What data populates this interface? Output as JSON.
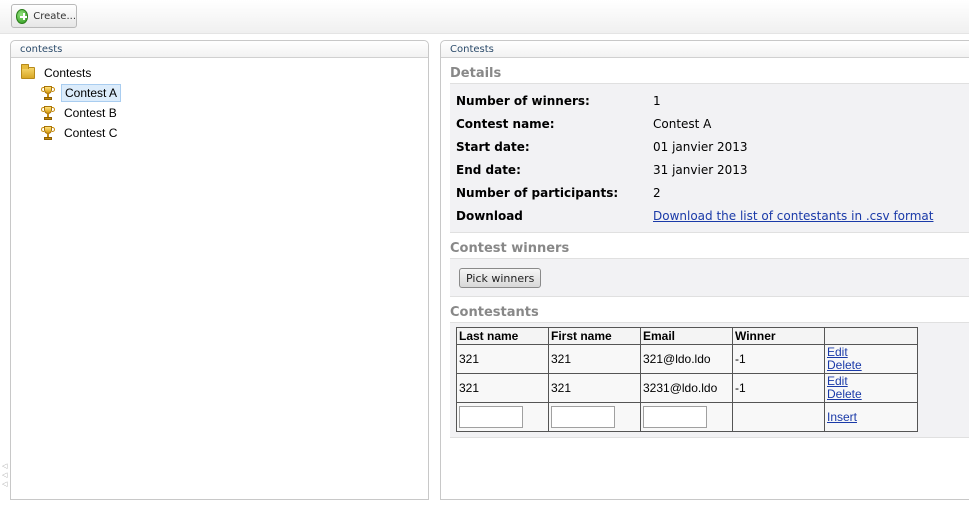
{
  "toolbar": {
    "create_label": "Create..."
  },
  "left_panel": {
    "header": "contests",
    "tree": {
      "root_label": "Contests",
      "items": [
        {
          "label": "Contest A",
          "selected": true
        },
        {
          "label": "Contest B",
          "selected": false
        },
        {
          "label": "Contest C",
          "selected": false
        }
      ]
    }
  },
  "right_panel": {
    "header": "Contests",
    "details": {
      "title": "Details",
      "rows": [
        {
          "label": "Number of winners:",
          "value": "1"
        },
        {
          "label": "Contest name:",
          "value": "Contest A"
        },
        {
          "label": "Start date:",
          "value": "01 janvier 2013"
        },
        {
          "label": "End date:",
          "value": "31 janvier 2013"
        },
        {
          "label": "Number of participants:",
          "value": "2"
        },
        {
          "label": "Download",
          "link": "Download the list of contestants in .csv format"
        }
      ]
    },
    "winners": {
      "title": "Contest winners",
      "pick_label": "Pick winners"
    },
    "contestants": {
      "title": "Contestants",
      "columns": [
        "Last name",
        "First name",
        "Email",
        "Winner",
        ""
      ],
      "rows": [
        {
          "last": "321",
          "first": "321",
          "email": "321@ldo.ldo",
          "winner": "-1",
          "edit": "Edit",
          "delete": "Delete"
        },
        {
          "last": "321",
          "first": "321",
          "email": "3231@ldo.ldo",
          "winner": "-1",
          "edit": "Edit",
          "delete": "Delete"
        }
      ],
      "insert_label": "Insert"
    }
  },
  "colors": {
    "link": "#1a3aa8",
    "selected_bg": "#dcecfb",
    "section_title": "#888888"
  }
}
